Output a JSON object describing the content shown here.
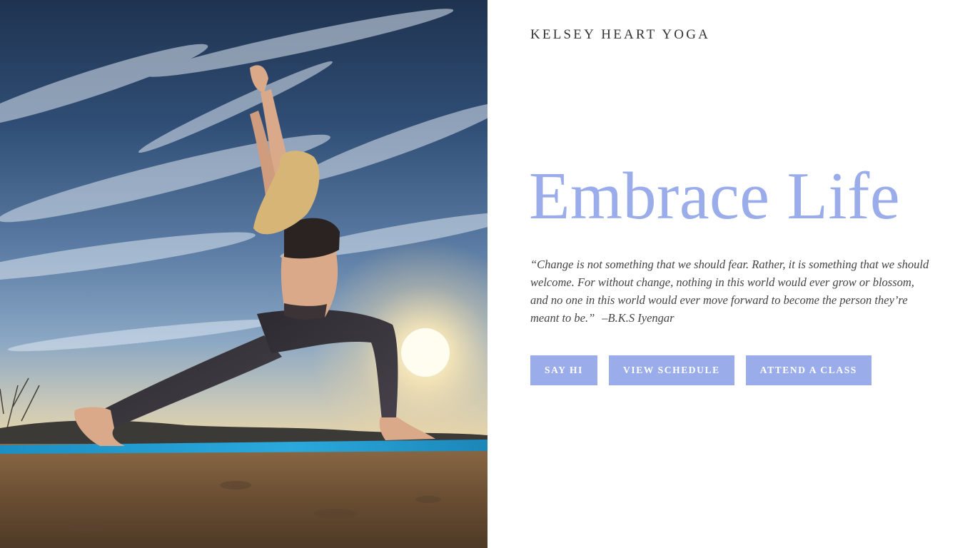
{
  "brand": {
    "name": "KELSEY HEART YOGA"
  },
  "hero": {
    "image_subject": "yoga-warrior-pose-photo"
  },
  "main": {
    "headline": "Embrace Life",
    "quote": "“Change is not something that we should fear. Rather, it is something that we should welcome. For without change, nothing in this world would ever grow or blossom, and no one in this world would ever move forward to become the person they’re meant to be.”",
    "quote_author": "–B.K.S Iyengar"
  },
  "buttons": {
    "say_hi": "SAY HI",
    "view_schedule": "VIEW SCHEDULE",
    "attend_class": "ATTEND A CLASS"
  },
  "colors": {
    "accent": "#9aacea",
    "text": "#444444",
    "brand_text": "#333333",
    "background": "#ffffff"
  }
}
